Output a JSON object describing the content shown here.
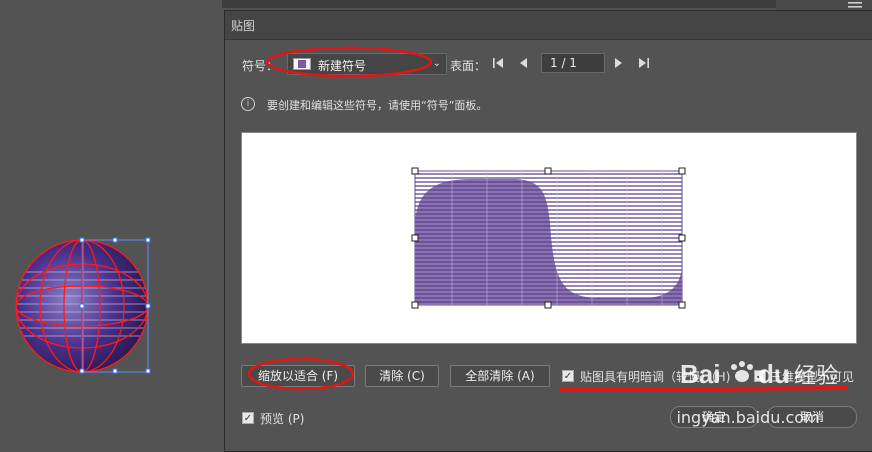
{
  "dialog": {
    "title": "贴图",
    "symbol_label": "符号：",
    "symbol_value": "新建符号",
    "surface_label": "表面：",
    "page_value": "1 / 1",
    "info_text": "要创建和编辑这些符号，请使用“符号”面板。",
    "buttons": {
      "scale_to_fit": "缩放以适合 (F)",
      "clear": "清除 (C)",
      "clear_all": "全部清除 (A)",
      "ok": "确定",
      "cancel": "取消"
    },
    "checkboxes": {
      "shade_artwork": {
        "label": "贴图具有明暗调（较慢）(H)",
        "checked": true
      },
      "invisible_geometry": {
        "label": "三维模型不可见",
        "checked": true
      },
      "preview": {
        "label": "预览 (P)",
        "checked": true
      }
    }
  },
  "icons": {
    "first": "first-page-icon",
    "prev": "previous-page-icon",
    "next": "next-page-icon",
    "last": "last-page-icon",
    "info": "info-icon",
    "dropdown": "chevron-down-icon"
  },
  "watermark": {
    "brand": "Bai",
    "brand2": "du",
    "suffix": "经验",
    "url": "jingyan.baidu.com"
  },
  "colors": {
    "accent_red": "#e01616",
    "purple": "#7a5aa6",
    "dialog_bg": "#535353"
  }
}
